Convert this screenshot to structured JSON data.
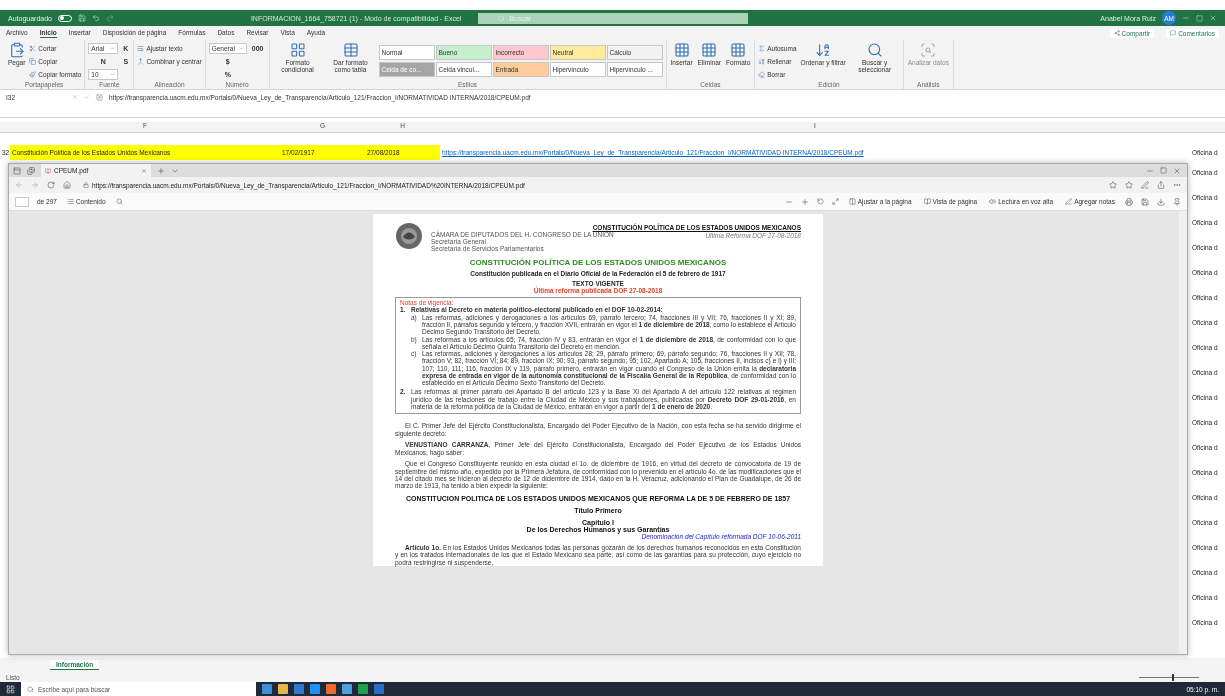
{
  "excel": {
    "title_bar": {
      "autosave_label": "Autoguardado",
      "autosave_on": false,
      "title": "INFORMACION_1664_758721 (1)  -  Modo de compatibilidad  -  Excel",
      "search_placeholder": "Buscar",
      "user_name": "Anabel Mora Ruiz",
      "user_initials": "AM"
    },
    "ribbon_tabs": [
      {
        "label": "Archivo",
        "selected": false
      },
      {
        "label": "Inicio",
        "selected": true
      },
      {
        "label": "Insertar",
        "selected": false
      },
      {
        "label": "Disposición de página",
        "selected": false
      },
      {
        "label": "Fórmulas",
        "selected": false
      },
      {
        "label": "Datos",
        "selected": false
      },
      {
        "label": "Revisar",
        "selected": false
      },
      {
        "label": "Vista",
        "selected": false
      },
      {
        "label": "Ayuda",
        "selected": false
      }
    ],
    "share_button": "Compartir",
    "comments_button": "Comentarios",
    "ribbon_groups": [
      {
        "label": "Portapapeles",
        "items": [
          {
            "kind": "large",
            "label": "Pegar",
            "disabled": false
          },
          {
            "kind": "small",
            "label": "Cortar"
          },
          {
            "kind": "small",
            "label": "Copiar"
          },
          {
            "kind": "small",
            "label": "Copiar formato"
          }
        ]
      },
      {
        "label": "Fuente",
        "items": [
          {
            "kind": "dropdown",
            "label": "Arial"
          },
          {
            "kind": "letter",
            "label": "N"
          },
          {
            "kind": "dropdown",
            "label": "10"
          },
          {
            "kind": "letter",
            "label": "K"
          },
          {
            "kind": "letter",
            "label": "S"
          }
        ]
      },
      {
        "label": "Alineación",
        "items": [
          {
            "kind": "small",
            "label": "Ajustar texto"
          },
          {
            "kind": "small",
            "label": "Combinar y centrar"
          }
        ]
      },
      {
        "label": "Número",
        "items": [
          {
            "kind": "dropdown",
            "label": "General"
          },
          {
            "kind": "letter",
            "label": "$"
          },
          {
            "kind": "letter",
            "label": "%"
          },
          {
            "kind": "letter",
            "label": "000"
          }
        ]
      },
      {
        "label": "Estilos",
        "items": [
          {
            "kind": "large",
            "label": "Formato condicional",
            "disabled": false
          },
          {
            "kind": "large",
            "label": "Dar formato como tabla",
            "disabled": false
          },
          {
            "kind": "style",
            "label": "Normal",
            "color": "#ffffff"
          },
          {
            "kind": "style",
            "label": "Celda de co...",
            "color": "#a5a5a5"
          },
          {
            "kind": "style",
            "label": "Bueno",
            "color": "#c6efce"
          },
          {
            "kind": "style",
            "label": "Celda vincul...",
            "color": "#fdfdfd"
          },
          {
            "kind": "style",
            "label": "Incorrecto",
            "color": "#ffc7ce"
          },
          {
            "kind": "style",
            "label": "Entrada",
            "color": "#ffcc99"
          },
          {
            "kind": "style",
            "label": "Neutral",
            "color": "#ffeb9c"
          },
          {
            "kind": "style",
            "label": "Hipervínculo",
            "color": "#fefefe"
          },
          {
            "kind": "style",
            "label": "Cálculo",
            "color": "#f2f2f2"
          },
          {
            "kind": "style",
            "label": "Hipervínculo ...",
            "color": "#fcfcfc"
          }
        ]
      },
      {
        "label": "Celdas",
        "items": [
          {
            "kind": "large",
            "label": "Insertar",
            "disabled": false
          },
          {
            "kind": "large",
            "label": "Eliminar",
            "disabled": false
          },
          {
            "kind": "large",
            "label": "Formato",
            "disabled": false
          }
        ]
      },
      {
        "label": "Edición",
        "items": [
          {
            "kind": "small",
            "label": "Autosuma"
          },
          {
            "kind": "small",
            "label": "Rellenar"
          },
          {
            "kind": "small",
            "label": "Borrar"
          },
          {
            "kind": "large",
            "label": "Ordenar y filtrar",
            "disabled": false
          },
          {
            "kind": "large",
            "label": "Buscar y seleccionar",
            "disabled": false
          }
        ]
      },
      {
        "label": "Análisis",
        "items": [
          {
            "kind": "large",
            "label": "Analizar datos",
            "disabled": true
          }
        ]
      }
    ],
    "name_box": "I32",
    "formula": "https://transparencia.uacm.edu.mx/Portals/0/Nueva_Ley_de_Transparencia/Articulo_121/Fraccion_I/NORMATIVIDAD INTERNA/2018/CPEUM.pdf",
    "columns": [
      "F",
      "G",
      "H",
      "I"
    ],
    "row": {
      "number": "32",
      "f": "Constitución Política de los Estados Unidos Mexicanos",
      "g": "17/02/1917",
      "h": "27/08/2018",
      "i": "https://transparencia.uacm.edu.mx/Portals/0/Nueva_Ley_de_Transparencia/Articulo_121/Fraccion_I/NORMATIVIDAD INTERNA/2018/CPEUM.pdf",
      "column_j": "Oficina d"
    },
    "column_j_cells": [
      "Oficina d",
      "Oficina d",
      "Oficina d",
      "Oficina d",
      "Oficina d",
      "Oficina d",
      "Oficina d",
      "Oficina d",
      "Oficina d",
      "Oficina d",
      "Oficina d",
      "Oficina d",
      "Oficina d",
      "Oficina d",
      "Oficina d",
      "Oficina d",
      "Oficina d",
      "Oficina d",
      "Oficina d"
    ],
    "sheet_tabs": [
      {
        "label": "Información",
        "selected": true
      }
    ],
    "status": "Listo",
    "zoom": {
      "level": 0.55
    }
  },
  "browser": {
    "tab_title": "CPEUM.pdf",
    "address": "https://transparencia.uacm.edu.mx/Portals/0/Nueva_Ley_de_Transparencia/Articulo_121/Fraccion_I/NORMATIVIDAD%20INTERNA/2018/CPEUM.pdf",
    "page_count": "de 297",
    "contents_button": "Contenido",
    "tools": [
      "Ajustar a la página",
      "Vista de página",
      "Lectura en voz alta",
      "Agregar notas"
    ],
    "pdf": {
      "header_title": "CONSTITUCIÓN POLÍTICA DE LOS ESTADOS UNIDOS MEXICANOS",
      "header_lines": [
        "CÁMARA DE DIPUTADOS DEL H. CONGRESO DE LA UNIÓN",
        "Secretaría General",
        "Secretaría de Servicios Parlamentarios"
      ],
      "header_reform": "Última Reforma DOF 27-08-2018",
      "title": "CONSTITUCIÓN POLÍTICA DE LOS ESTADOS UNIDOS MEXICANOS",
      "subtitle": "Constitución publicada en el Diario Oficial de la Federación el 5 de febrero de 1917",
      "status_heading": "TEXTO VIGENTE",
      "status_reform": "Última reforma publicada DOF 27-08-2018",
      "notes": {
        "heading": "Notas de vigencia:",
        "items": [
          {
            "number": "1.",
            "text": "**Relativas al Decreto en materia político-electoral publicado en el DOF 10-02-2014:**",
            "children": [
              {
                "number": "a)",
                "text": "Las reformas, adiciones y derogaciones a los artículos 69, párrafo tercero; 74, fracciones III y VII; 76, fracciones II y XI; 89, fracción II, párrafos segundo y tercero, y fracción XVII, entrarán en vigor el **1 de diciembre de 2018**, como lo establece el Artículo Décimo Segundo Transitorio del Decreto."
              },
              {
                "number": "b)",
                "text": "Las reformas a los artículos 65; 74, fracción IV y 83, entrarán en vigor el **1 de diciembre de 2018**, de conformidad con lo que señala el Artículo Décimo Quinto Transitorio del Decreto en mención."
              },
              {
                "number": "c)",
                "text": "Las reformas, adiciones y derogaciones a los artículos 28; 29, párrafo primero; 69, párrafo segundo; 76, fracciones II y XII; 78, fracción V; 82, fracción VI; 84; 89, fracción IX; 90; 93, párrafo segundo; 95; 102, Apartado A; 105, fracciones II, incisos c) e i) y III; 107; 110, 111; 116, fracción IX y 119, párrafo primero, entrarán en vigor cuando el Congreso de la Unión emita la **declaratoria expresa de entrada en vigor de la autonomía constitucional de la Fiscalía General de la República**, de conformidad con lo establecido en el Artículo Décimo Sexto Transitorio del Decreto."
              }
            ]
          },
          {
            "number": "2.",
            "text": "Las reformas al primer párrafo del Apartado B del artículo 123 y la Base XI del Apartado A del artículo 122 relativas al régimen jurídico de las relaciones de trabajo entre la Ciudad de México y sus trabajadores, publicadas por **Decreto DOF 29-01-2016**, en materia de la reforma política de la Ciudad de México, entrarán en vigor a partir del **1 de enero de 2020**."
          }
        ]
      },
      "body": [
        {
          "kind": "paragraph",
          "text": "El C. Primer Jefe del Ejército Constitucionalista, Encargado del Poder Ejecutivo de la Nación, con esta fecha se ha servido dirigirme el siguiente decreto:"
        },
        {
          "kind": "paragraph",
          "text": "**VENUSTIANO CARRANZA**, Primer Jefe del Ejército Constitucionalista, Encargado del Poder Ejecutivo de los Estados Unidos Mexicanos, hago saber:"
        },
        {
          "kind": "paragraph",
          "text": "Que el Congreso Constituyente reunido en esta ciudad el 1o. de diciembre de 1916, en virtud del decreto de convocatoria de 19 de septiembre del mismo año, expedido por la Primera Jefatura, de conformidad con lo prevenido en el artículo 4o. de las modificaciones que el 14 del citado mes se hicieron al decreto de 12 de diciembre de 1914, dado en la H. Veracruz, adicionando el Plan de Guadalupe, de 26 de marzo de 1913, ha tenido a bien expedir la siguiente:"
        },
        {
          "kind": "heading",
          "text": "CONSTITUCION POLITICA DE LOS ESTADOS UNIDOS MEXICANOS QUE REFORMA LA DE 5 DE FEBRERO DE 1857"
        },
        {
          "kind": "heading",
          "text": "Título Primero"
        },
        {
          "kind": "heading",
          "text": "Capítulo I"
        },
        {
          "kind": "subheading",
          "text": "De los Derechos Humanos y sus Garantías"
        },
        {
          "kind": "note",
          "text": "Denominación del Capítulo reformada DOF 10-06-2011"
        },
        {
          "kind": "paragraph",
          "text": "**Artículo 1o.** En los Estados Unidos Mexicanos todas las personas gozarán de los derechos humanos reconocidos en esta Constitución y en los tratados internacionales de los que el Estado Mexicano sea parte, así como de las garantías para su protección, cuyo ejercicio no podrá restringirse ni suspenderse,"
        }
      ]
    }
  },
  "taskbar": {
    "search_placeholder": "Escribe aquí para buscar",
    "time": "05:10 p. m."
  }
}
